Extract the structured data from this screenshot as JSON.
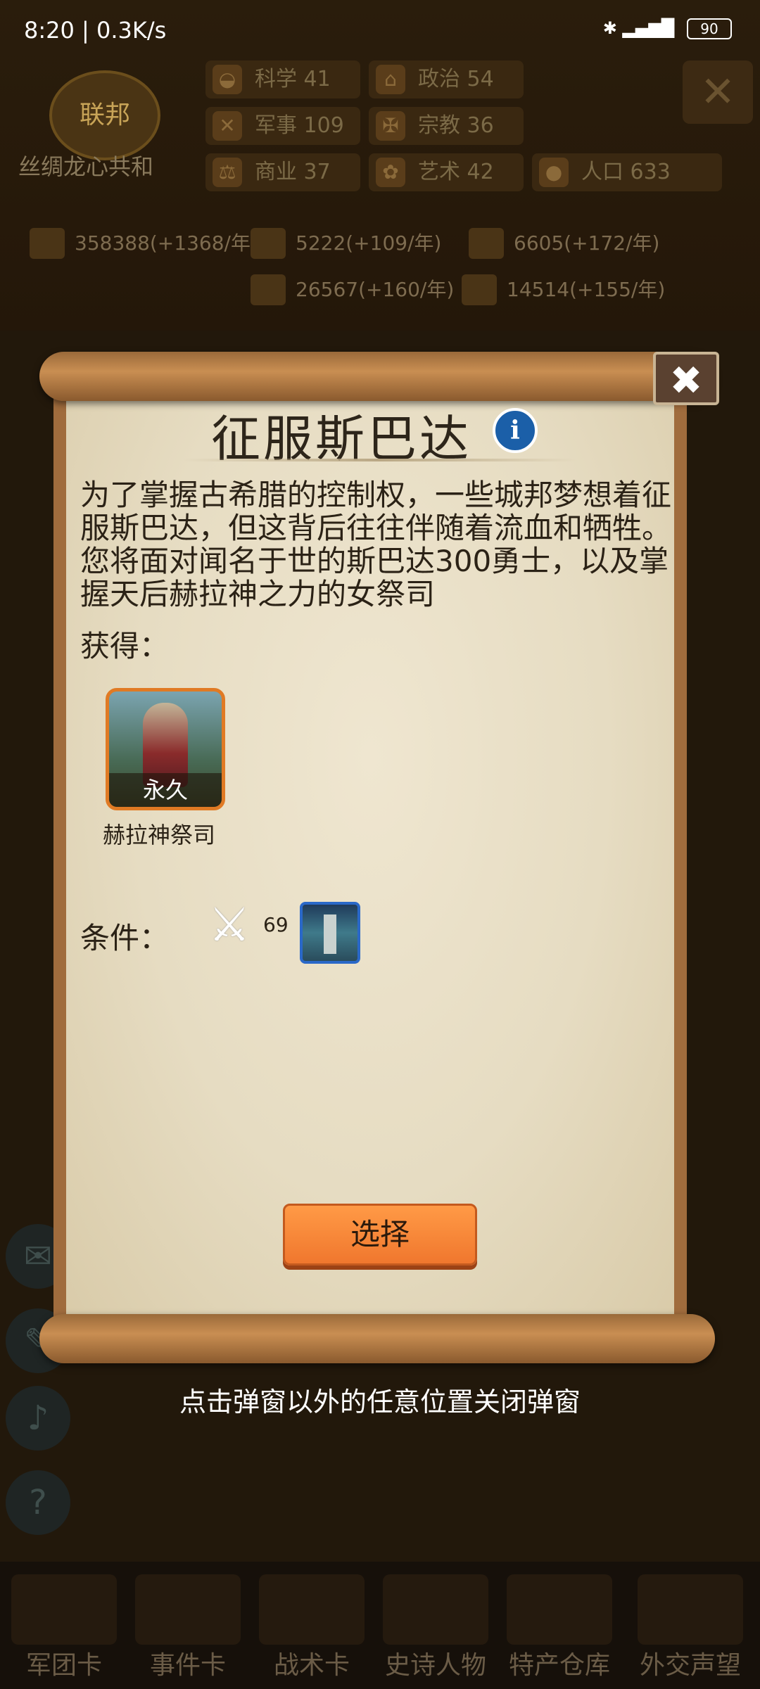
{
  "status_bar": {
    "time": "8:20 | 0.3K/s",
    "battery": "90"
  },
  "nation": {
    "emblem": "联邦",
    "name": "丝绸龙心共和"
  },
  "stats": [
    {
      "label": "科学",
      "value": "41",
      "icon": "science-icon"
    },
    {
      "label": "政治",
      "value": "54",
      "icon": "politics-icon"
    },
    {
      "label": "军事",
      "value": "109",
      "icon": "military-icon"
    },
    {
      "label": "宗教",
      "value": "36",
      "icon": "religion-icon"
    },
    {
      "label": "商业",
      "value": "37",
      "icon": "commerce-icon"
    },
    {
      "label": "艺术",
      "value": "42",
      "icon": "art-icon"
    },
    {
      "label": "人口",
      "value": "633",
      "icon": "population-icon"
    }
  ],
  "resources": [
    "358388(+1368/年)",
    "5222(+109/年)",
    "6605(+172/年)",
    "26567(+160/年)",
    "14514(+155/年)"
  ],
  "popup": {
    "title": "征服斯巴达",
    "description": "为了掌握古希腊的控制权，一些城邦梦想着征服斯巴达，但这背后往往伴随着流血和牺牲。您将面对闻名于世的斯巴达300勇士，以及掌握天后赫拉神之力的女祭司",
    "obtain_label": "获得：",
    "reward": {
      "tag": "永久",
      "name": "赫拉神祭司"
    },
    "condition_label": "条件：",
    "condition_value": "69",
    "select_label": "选择",
    "close_symbol": "✖"
  },
  "hint": "点击弹窗以外的任意位置关闭弹窗",
  "bottom_tabs": [
    "军团卡",
    "事件卡",
    "战术卡",
    "史诗人物",
    "特产仓库",
    "外交声望"
  ]
}
